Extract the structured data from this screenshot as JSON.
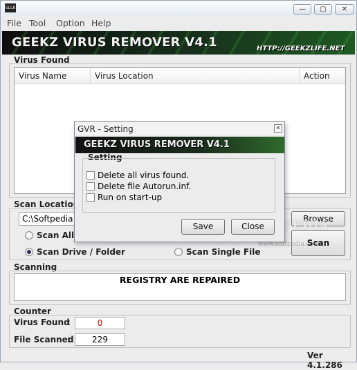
{
  "window": {
    "icon_text": "GLLK",
    "controls": {
      "minimize": "—",
      "maximize": "▢",
      "close": "✕"
    }
  },
  "menu": [
    "File",
    "Tool",
    "Option",
    "Help"
  ],
  "banner": {
    "title": "GEEKZ VIRUS REMOVER V4.1",
    "url": "HTTP://GEEKZLIFE.NET"
  },
  "virus_found": {
    "label": "Virus Found",
    "columns": [
      "Virus Name",
      "Virus Location",
      "Action"
    ]
  },
  "scan_location": {
    "label": "Scan Location",
    "path": "C:\\Softpedia",
    "options": {
      "all_drives": "Scan All D",
      "drive_folder": "Scan Drive / Folder",
      "single_file": "Scan Single File"
    },
    "selected": "drive_folder"
  },
  "buttons": {
    "browse": "Browse",
    "scan": "Scan"
  },
  "scanning": {
    "label": "Scanning",
    "status": "REGISTRY ARE REPAIRED"
  },
  "counter": {
    "label": "Counter",
    "virus_found_label": "Virus Found",
    "virus_found_value": "0",
    "file_scanned_label": "File Scanned",
    "file_scanned_value": "229",
    "colon": ":",
    "virus_value_color": "#e00000"
  },
  "version": "Ver 4.1.286",
  "dialog": {
    "title": "GVR - Setting",
    "close_glyph": "✕",
    "banner_title": "GEEKZ VIRUS REMOVER V4.1",
    "group_label": "Setting",
    "options": [
      {
        "label": "Delete all virus found.",
        "checked": false
      },
      {
        "label": "Delete file Autorun.inf.",
        "checked": false
      },
      {
        "label": "Run on start-up",
        "checked": false
      }
    ],
    "save": "Save",
    "close": "Close"
  },
  "watermark": {
    "main": "SOFTPEDIA",
    "sub": "www.softpedia.com"
  }
}
